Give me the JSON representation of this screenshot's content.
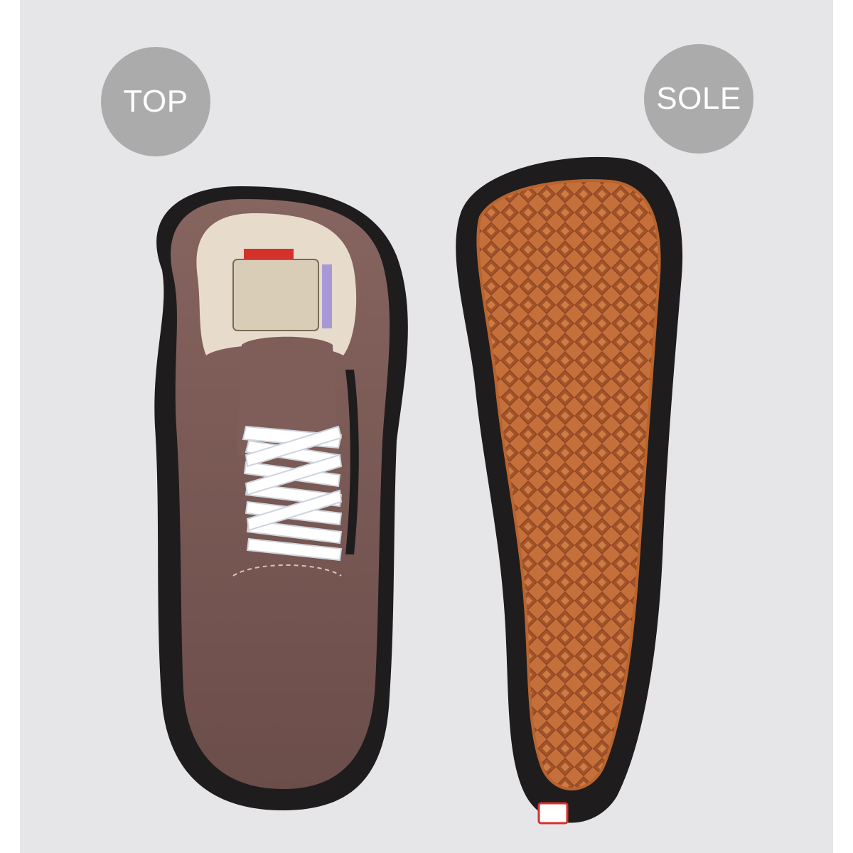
{
  "labels": {
    "top": "TOP",
    "sole": "SOLE"
  },
  "colors": {
    "background": "#e6e6e9",
    "badge": "#ababab",
    "suede": "#7b5a56",
    "outsole": "#1f1c1d",
    "gum": "#c5703a",
    "liner": "#e7dccb",
    "laces": "#ffffff"
  }
}
